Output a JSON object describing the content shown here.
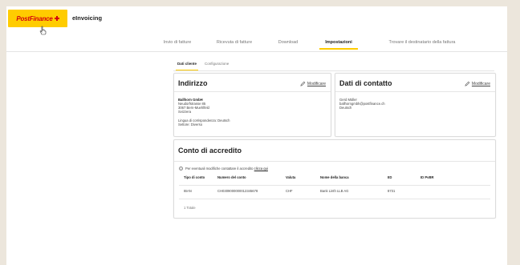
{
  "header": {
    "logo_text": "PostFinance",
    "app_name": "eInvoicing"
  },
  "nav": {
    "items": [
      {
        "label": "Invio di fatture"
      },
      {
        "label": "Ricevuta di fatture"
      },
      {
        "label": "Download"
      },
      {
        "label": "Impostazioni"
      },
      {
        "label": "Trovare il destinatario della fattura"
      }
    ]
  },
  "subtabs": {
    "items": [
      {
        "label": "Dati cliente"
      },
      {
        "label": "Configurazione"
      }
    ]
  },
  "address_card": {
    "title": "Indirizzo",
    "edit_label": "Modificare",
    "company": "Ballhorn GmbH",
    "street": "Neudorfstrasse 85",
    "city": "3067 Bern-Muehlfeld",
    "country": "Svizzera",
    "language": "Lingua di corrispondenza: Deutsch",
    "sector": "Settore: Diverso"
  },
  "contact_card": {
    "title": "Dati di contatto",
    "edit_label": "Modificare",
    "name": "Gerd Müller",
    "email": "ballhorngmbh@postfinance.ch",
    "language": "Deutsch"
  },
  "account_card": {
    "title": "Conto di accredito",
    "info_prefix": "Per eventuali modifiche contattare il accredito",
    "info_link": "clicca qui",
    "columns": [
      "Tipo di conto",
      "Numero del conto",
      "Valuta",
      "Nome della banca",
      "IID",
      "ID PvBR"
    ],
    "rows": [
      [
        "IBAN",
        "CH0309000000012345678",
        "CHF",
        "Bank Linth LLB AG",
        "8731",
        ""
      ]
    ],
    "total": "1 Totale"
  }
}
